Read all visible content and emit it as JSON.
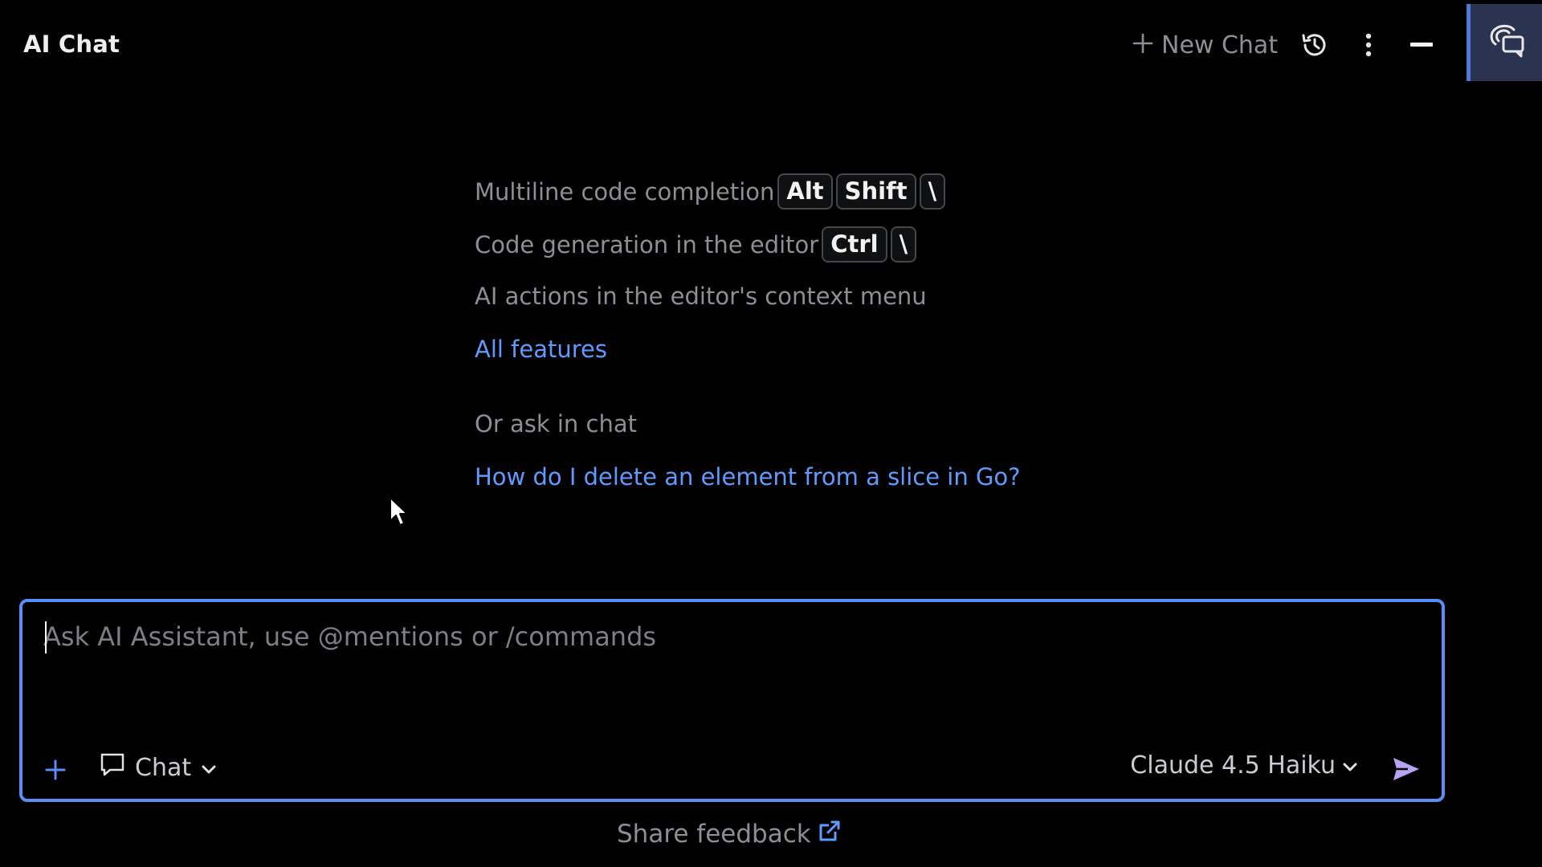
{
  "header": {
    "title": "AI Chat",
    "new_chat_label": "New Chat",
    "icons": {
      "new_chat": "plus-icon",
      "history": "history-icon",
      "more": "more-vertical-icon",
      "minimize": "minimize-icon",
      "tool_window": "ai-chat-icon"
    }
  },
  "features": {
    "items": [
      {
        "label": "Multiline code completion",
        "keys": [
          "Alt",
          "Shift",
          "\\"
        ]
      },
      {
        "label": "Code generation in the editor",
        "keys": [
          "Ctrl",
          "\\"
        ]
      },
      {
        "label": "AI actions in the editor's context menu",
        "keys": []
      }
    ],
    "all_features_link": "All features",
    "ask_heading": "Or ask in chat",
    "suggestion_link": "How do I delete an element from a slice in Go?"
  },
  "input": {
    "placeholder": "Ask AI Assistant, use @mentions or /commands",
    "value": "",
    "mode_label": "Chat",
    "model_label": "Claude 4.5 Haiku"
  },
  "footer": {
    "feedback_label": "Share feedback"
  },
  "colors": {
    "background": "#000000",
    "accent_border": "#5a8ef7",
    "link": "#5f9bff",
    "muted_text": "#8c8f96",
    "send_icon": "#b9a1f5",
    "tool_button_bg": "#2a3450"
  }
}
